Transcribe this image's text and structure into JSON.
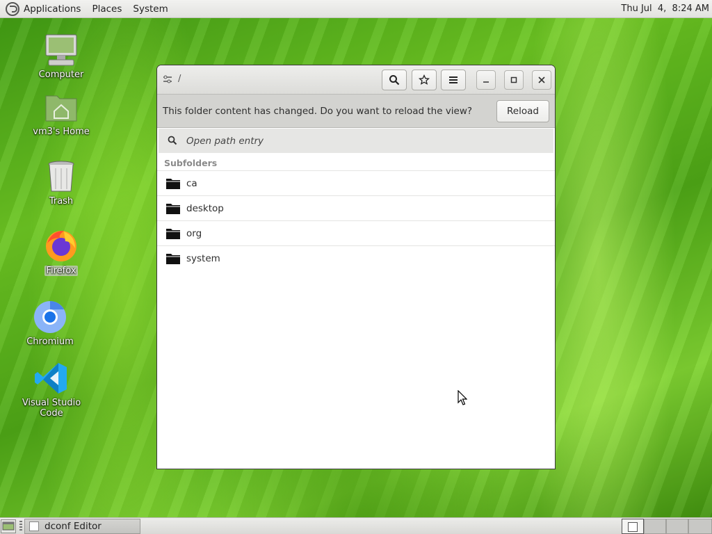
{
  "top_panel": {
    "menus": [
      "Applications",
      "Places",
      "System"
    ],
    "clock": "Thu Jul  4,  8:24 AM"
  },
  "desktop_icons": [
    {
      "label": "Computer",
      "icon": "computer-icon"
    },
    {
      "label": "vm3's Home",
      "icon": "home-folder-icon"
    },
    {
      "label": "Trash",
      "icon": "trash-icon"
    },
    {
      "label": "Firefox",
      "icon": "firefox-icon",
      "selected": true
    },
    {
      "label": "Chromium",
      "icon": "chromium-icon"
    },
    {
      "label": "Visual Studio Code",
      "icon": "vscode-icon"
    }
  ],
  "window": {
    "path": "/",
    "infobar": {
      "message": "This folder content has changed. Do you want to reload the view?",
      "button": "Reload"
    },
    "path_entry": {
      "placeholder": "Open path entry",
      "value": ""
    },
    "section_header": "Subfolders",
    "folders": [
      "ca",
      "desktop",
      "org",
      "system"
    ]
  },
  "taskbar": {
    "tasks": [
      {
        "label": "dconf Editor"
      }
    ]
  },
  "colors": {
    "desktop_green": "#5cb51c",
    "headerbar": "#e4e4e2",
    "infobar": "#d3d3d0"
  }
}
